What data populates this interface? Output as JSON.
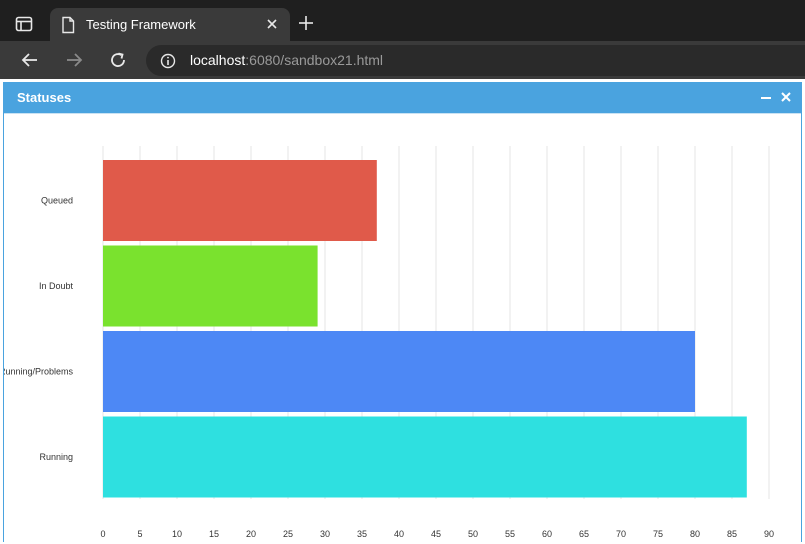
{
  "browser": {
    "tab_title": "Testing Framework",
    "url_host": "localhost",
    "url_rest": ":6080/sandbox21.html",
    "icons": {
      "tab_strip": "tab-strip-icon",
      "document": "document-icon",
      "close": "close-icon",
      "new_tab": "plus-icon",
      "back": "arrow-left-icon",
      "forward": "arrow-right-icon",
      "reload": "reload-icon",
      "info": "info-icon"
    }
  },
  "panel": {
    "title": "Statuses",
    "header_color": "#4aa3df"
  },
  "chart_data": {
    "type": "bar",
    "orientation": "horizontal",
    "categories": [
      "Queued",
      "In Doubt",
      "Running/Problems",
      "Running"
    ],
    "values": [
      37,
      29,
      80,
      87
    ],
    "colors": [
      "#e05a4a",
      "#7ae22e",
      "#4d88f5",
      "#2ee0e0"
    ],
    "xlim": [
      0,
      90
    ],
    "xticks": [
      0,
      5,
      10,
      15,
      20,
      25,
      30,
      35,
      40,
      45,
      50,
      55,
      60,
      65,
      70,
      75,
      80,
      85,
      90
    ],
    "grid": true,
    "legend": false
  }
}
